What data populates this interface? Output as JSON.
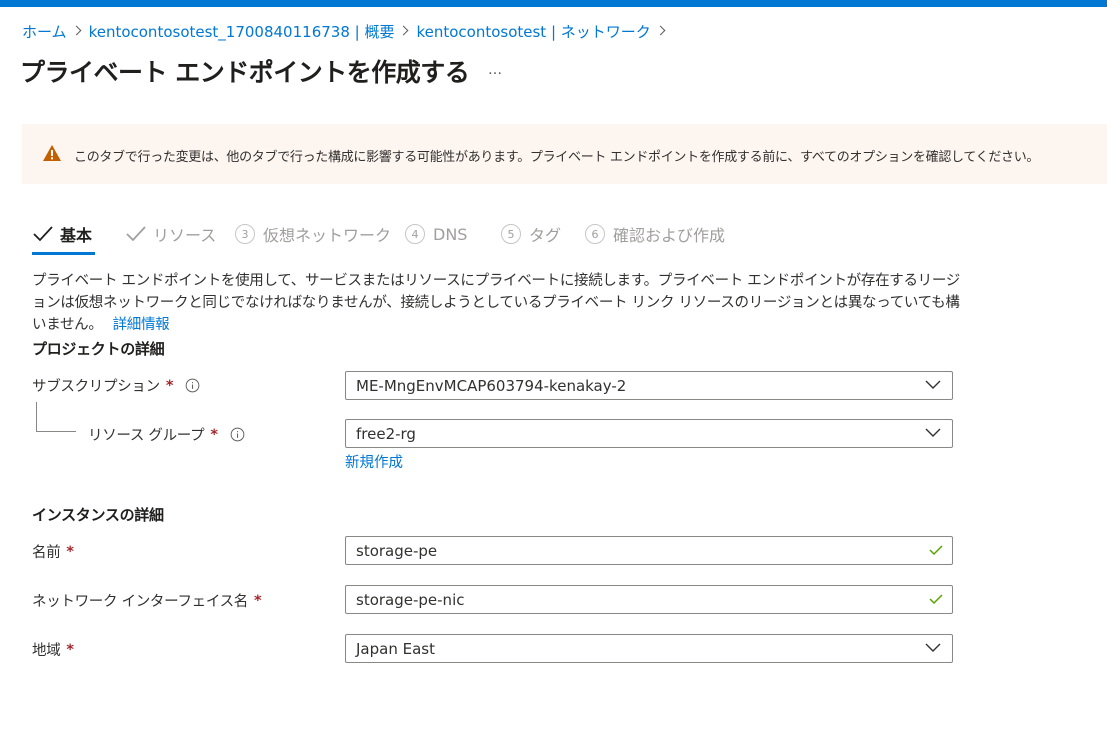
{
  "breadcrumb": {
    "items": [
      "ホーム",
      "kentocontosotest_1700840116738 | 概要",
      "kentocontosotest | ネットワーク"
    ]
  },
  "page": {
    "title": "プライベート エンドポイントを作成する",
    "more": "…"
  },
  "warning": {
    "text": "このタブで行った変更は、他のタブで行った構成に影響する可能性があります。プライベート エンドポイントを作成する前に、すべてのオプションを確認してください。"
  },
  "tabs": [
    {
      "label": "基本",
      "state": "active"
    },
    {
      "label": "リソース",
      "state": "done"
    },
    {
      "num": "3",
      "label": "仮想ネットワーク",
      "state": "disabled"
    },
    {
      "num": "4",
      "label": "DNS",
      "state": "disabled"
    },
    {
      "num": "5",
      "label": "タグ",
      "state": "disabled"
    },
    {
      "num": "6",
      "label": "確認および作成",
      "state": "disabled"
    }
  ],
  "description": {
    "text": "プライベート エンドポイントを使用して、サービスまたはリソースにプライベートに接続します。プライベート エンドポイントが存在するリージョンは仮想ネットワークと同じでなければなりませんが、接続しようとしているプライベート リンク リソースのリージョンとは異なっていても構いません。",
    "link": "詳細情報"
  },
  "project": {
    "heading": "プロジェクトの詳細",
    "subscription_label": "サブスクリプション",
    "subscription_value": "ME-MngEnvMCAP603794-kenakay-2",
    "resource_group_label": "リソース グループ",
    "resource_group_value": "free2-rg",
    "new_link": "新規作成"
  },
  "instance": {
    "heading": "インスタンスの詳細",
    "name_label": "名前",
    "name_value": "storage-pe",
    "nic_label": "ネットワーク インターフェイス名",
    "nic_value": "storage-pe-nic",
    "region_label": "地域",
    "region_value": "Japan East"
  },
  "required_mark": "*",
  "colors": {
    "accent": "#0078d4",
    "warning_bg": "#fdf5ef",
    "warning_icon": "#c25f00",
    "required": "#a4262c",
    "valid": "#57a300"
  }
}
